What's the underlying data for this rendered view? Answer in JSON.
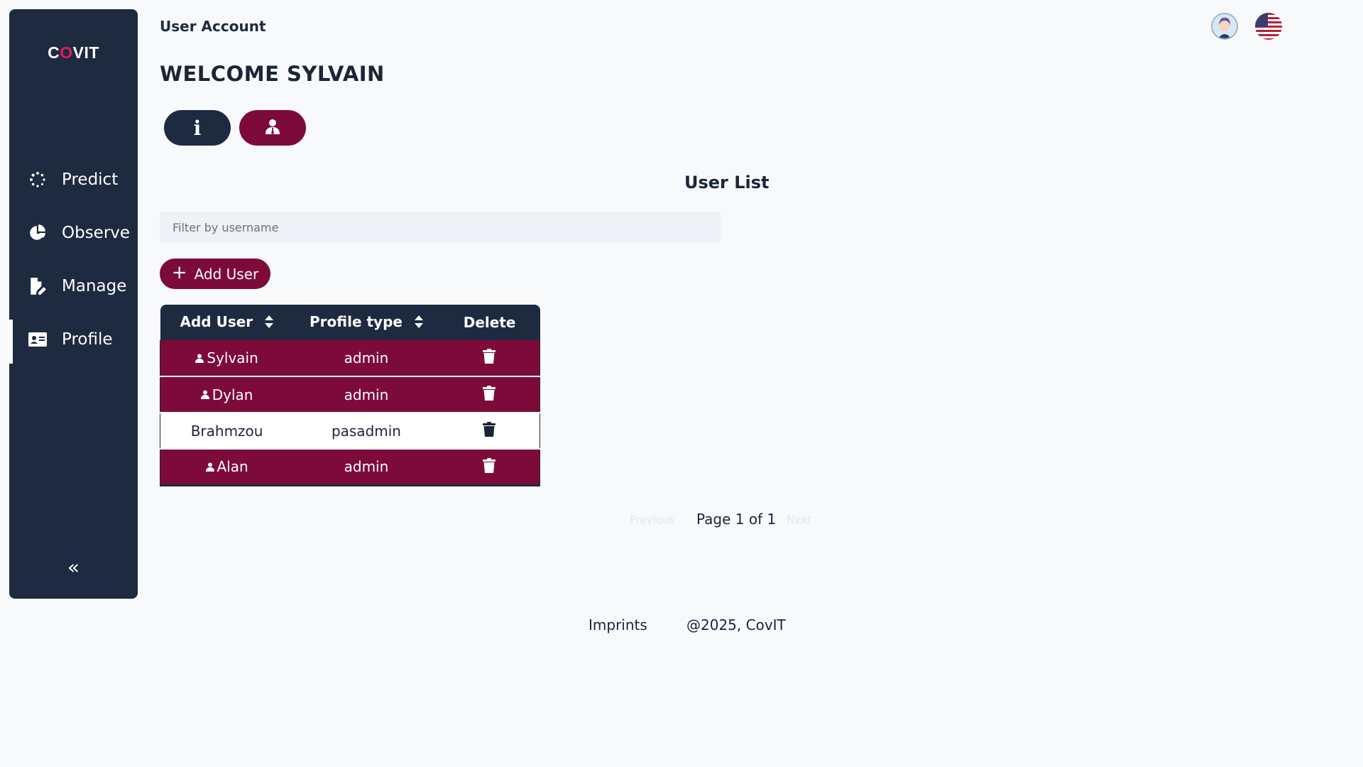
{
  "sidebar": {
    "logo_left": "C",
    "logo_mid": "O",
    "logo_right": "VIT",
    "items": [
      {
        "label": "Predict",
        "icon": "spinner-dots-icon"
      },
      {
        "label": "Observe",
        "icon": "pie-chart-icon"
      },
      {
        "label": "Manage",
        "icon": "file-edit-icon"
      },
      {
        "label": "Profile",
        "icon": "id-card-icon"
      }
    ],
    "collapse": "«"
  },
  "header": {
    "title": "User Account",
    "welcome": "WELCOME SYLVAIN"
  },
  "tabs": {
    "info": "i"
  },
  "user_list": {
    "title": "User List",
    "filter_placeholder": "Filter by username",
    "add_button": "Add User",
    "columns": [
      "Add User",
      "Profile type",
      "Delete"
    ],
    "rows": [
      {
        "name": "Sylvain",
        "type": "admin"
      },
      {
        "name": "Dylan",
        "type": "admin"
      },
      {
        "name": "Brahmzou",
        "type": "pasadmin"
      },
      {
        "name": "Alan",
        "type": "admin"
      }
    ]
  },
  "pagination": {
    "prev": "Previous",
    "text": "Page 1 of 1",
    "next": "Next"
  },
  "footer": {
    "imprints": "Imprints",
    "copyright": "@2025, CovIT"
  },
  "colors": {
    "sidebar": "#1e2a3f",
    "accent": "#7d0b3a",
    "logo_virus": "#e6166b",
    "background": "#f7f9fb"
  }
}
